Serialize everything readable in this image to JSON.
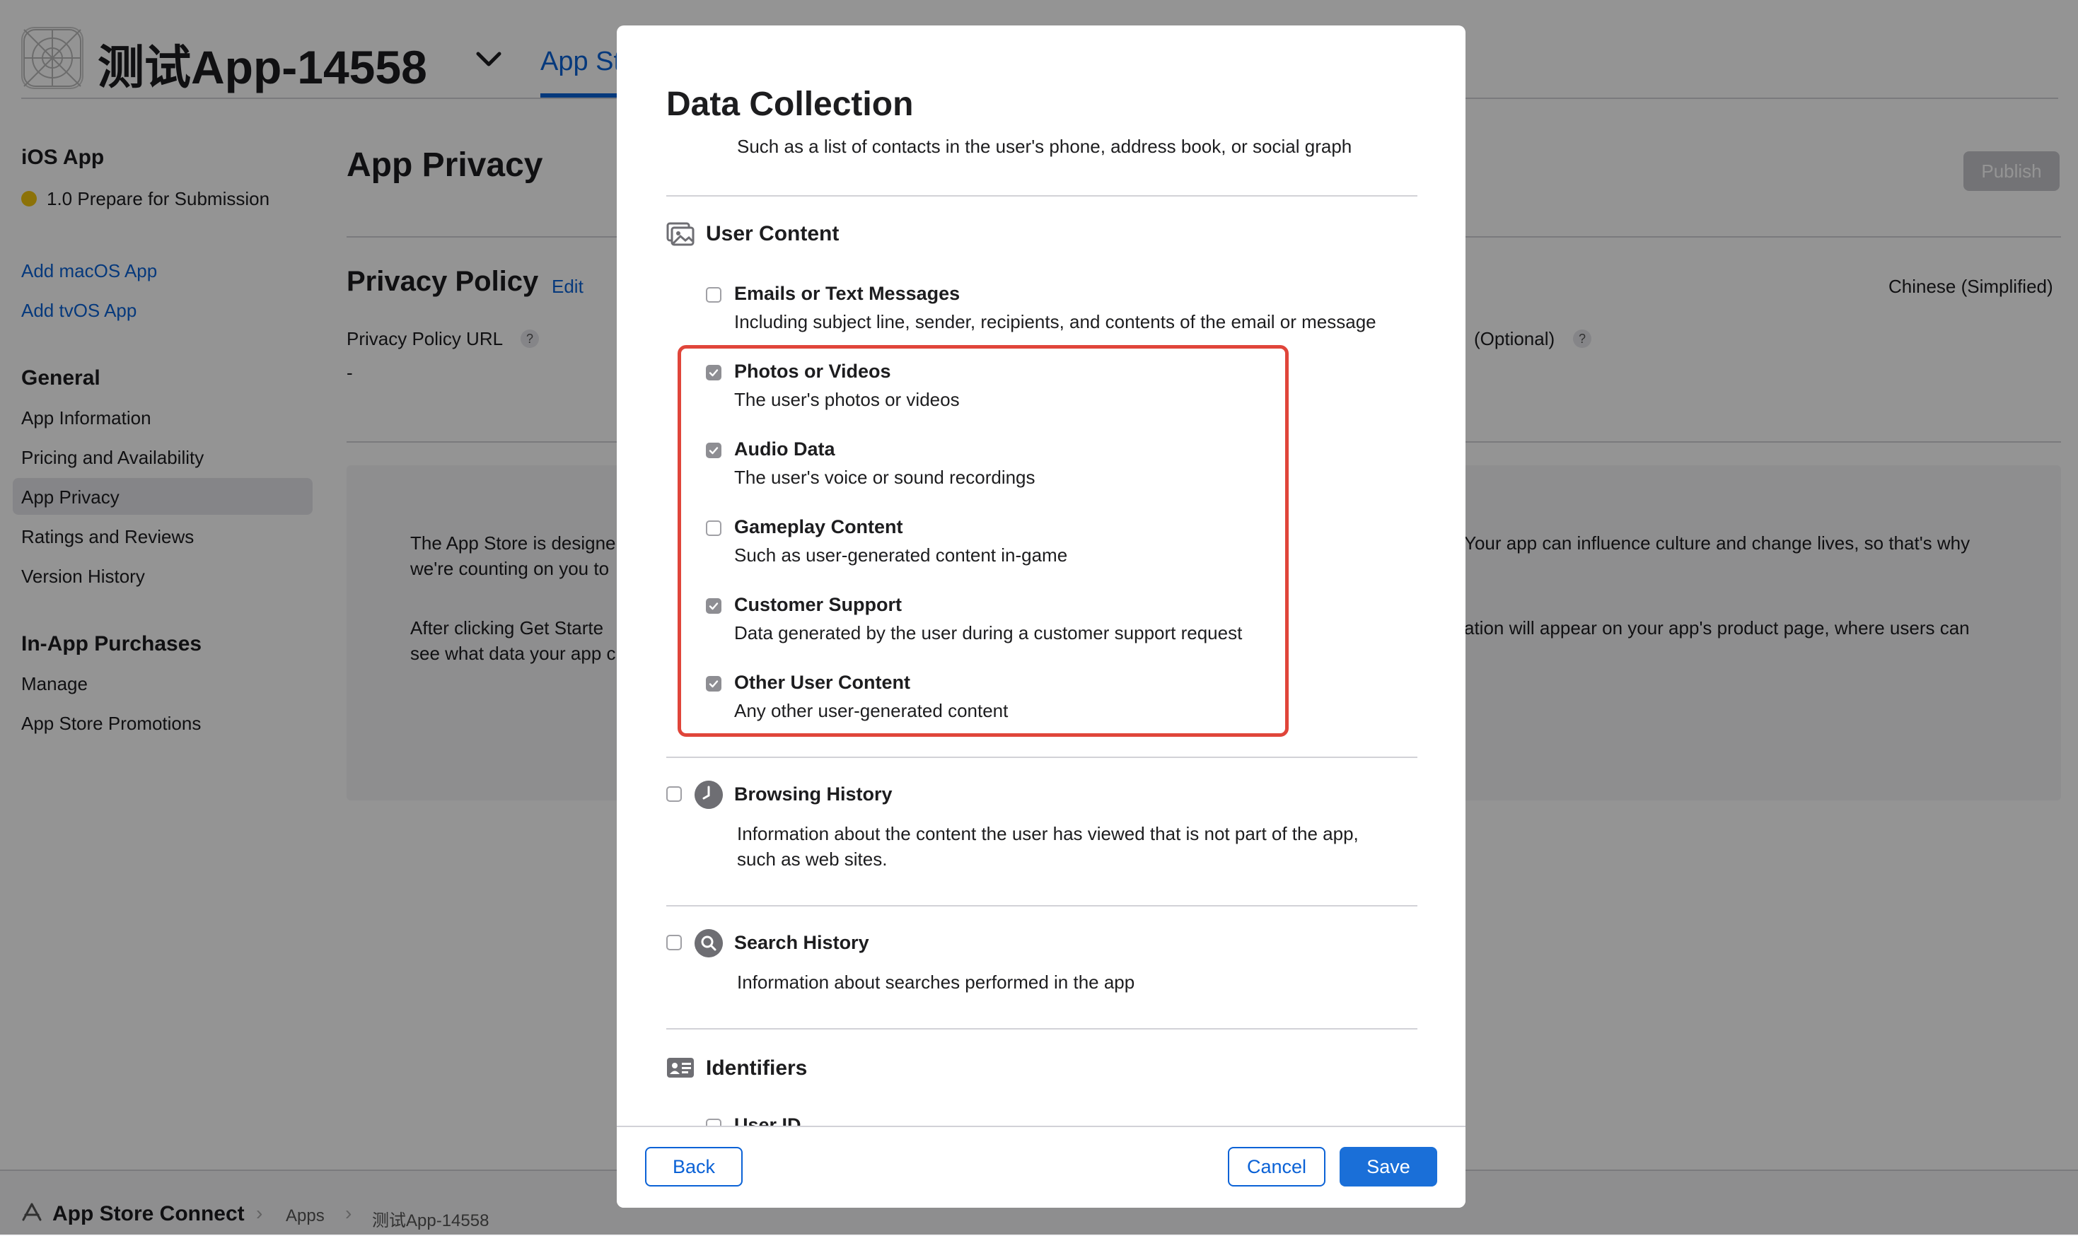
{
  "app": {
    "name": "测试App-14558",
    "top_tab": "App St"
  },
  "sidebar": {
    "ios_heading": "iOS App",
    "status": "1.0 Prepare for Submission",
    "add_links": [
      "Add macOS App",
      "Add tvOS App"
    ],
    "general_heading": "General",
    "general_items": [
      "App Information",
      "Pricing and Availability",
      "App Privacy",
      "Ratings and Reviews",
      "Version History"
    ],
    "selected_item": "App Privacy",
    "iap_heading": "In-App Purchases",
    "iap_items": [
      "Manage",
      "App Store Promotions"
    ]
  },
  "main": {
    "title": "App Privacy",
    "publish_label": "Publish",
    "privacy_policy_title": "Privacy Policy",
    "edit_label": "Edit",
    "language": "Chinese (Simplified)",
    "privacy_url_label": "Privacy Policy URL",
    "help_glyph": "?",
    "privacy_url_value": "-",
    "optional_label": "(Optional)",
    "info_left": [
      "The App Store is designe",
      "we're counting on you to",
      "After clicking Get Starte",
      "see what data your app c"
    ],
    "info_right": [
      "Your app can influence culture and change lives, so that's why",
      "ation will appear on your app's product page, where users can"
    ]
  },
  "footer": {
    "brand": "App Store Connect",
    "crumbs": [
      "Apps",
      "测试App-14558"
    ]
  },
  "modal": {
    "title": "Data Collection",
    "subtitle": "Such as a list of contacts in the user's phone, address book, or social graph",
    "user_content": {
      "title": "User Content",
      "options": [
        {
          "title": "Emails or Text Messages",
          "desc": "Including subject line, sender, recipients, and contents of the email or message",
          "checked": false
        },
        {
          "title": "Photos or Videos",
          "desc": "The user's photos or videos",
          "checked": true
        },
        {
          "title": "Audio Data",
          "desc": "The user's voice or sound recordings",
          "checked": true
        },
        {
          "title": "Gameplay Content",
          "desc": "Such as user-generated content in-game",
          "checked": false
        },
        {
          "title": "Customer Support",
          "desc": "Data generated by the user during a customer support request",
          "checked": true
        },
        {
          "title": "Other User Content",
          "desc": "Any other user-generated content",
          "checked": true
        }
      ]
    },
    "browsing_history": {
      "title": "Browsing History",
      "desc_line1": "Information about the content the user has viewed that is not part of the app,",
      "desc_line2": "such as web sites.",
      "checked": false
    },
    "search_history": {
      "title": "Search History",
      "desc": "Information about searches performed in the app",
      "checked": false
    },
    "identifiers": {
      "title": "Identifiers",
      "partial_option": "User ID"
    },
    "buttons": {
      "back": "Back",
      "cancel": "Cancel",
      "save": "Save"
    }
  },
  "colors": {
    "accent": "#0b62d6",
    "primary_button": "#1a6fd8",
    "highlight_border": "#e0453a",
    "checkbox_checked": "#8e8e93",
    "status_dot": "#f1c40f"
  }
}
